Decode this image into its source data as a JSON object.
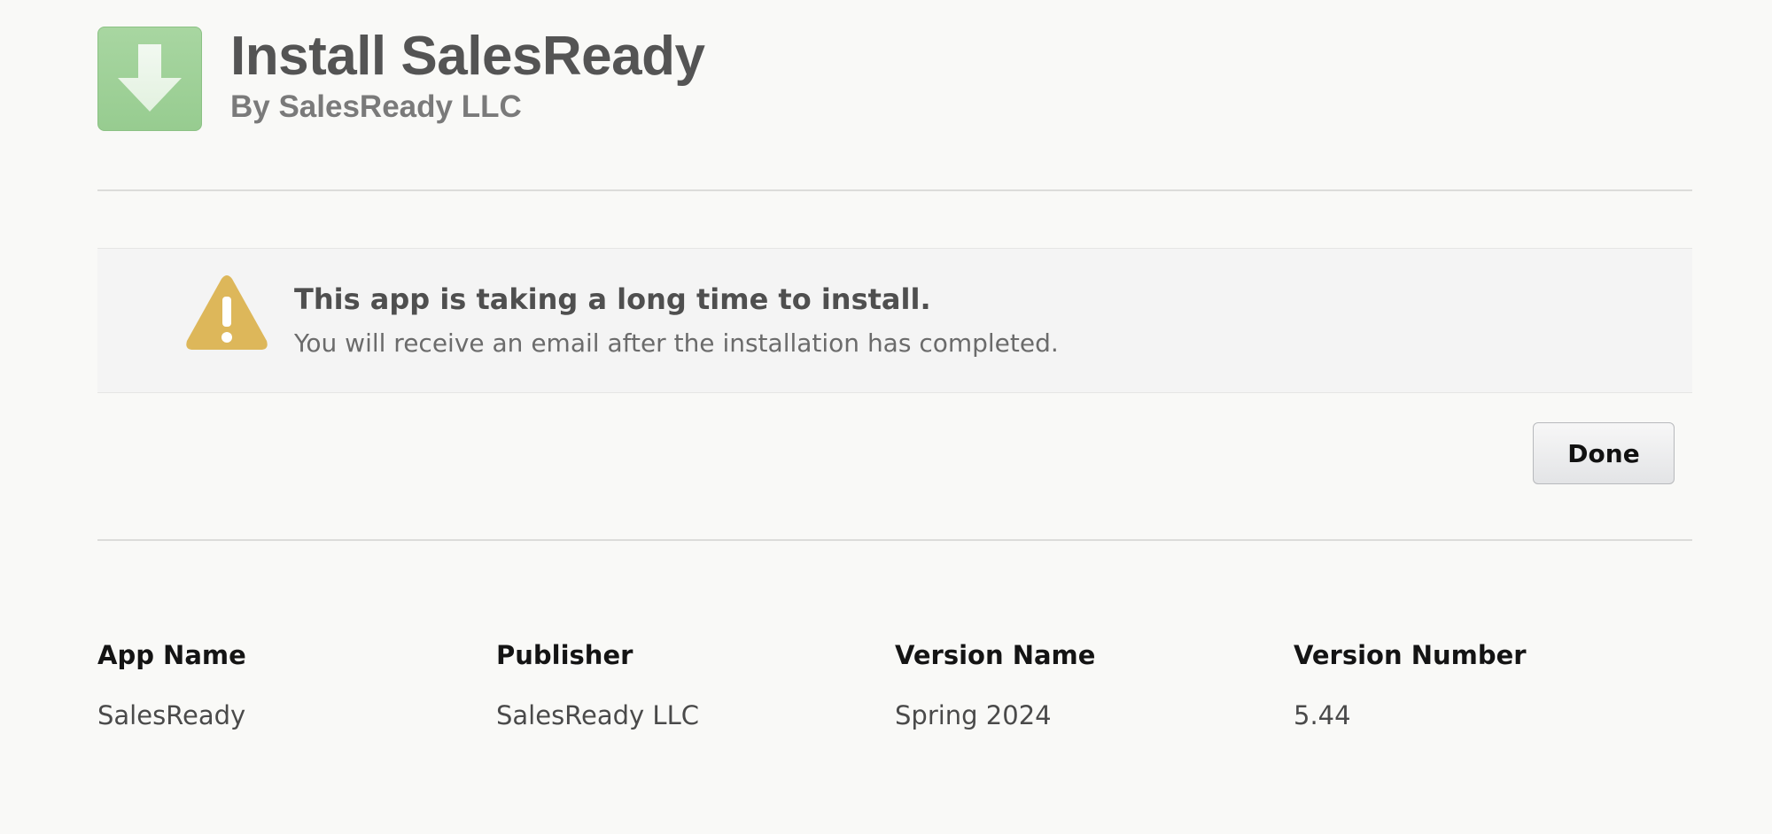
{
  "header": {
    "title": "Install SalesReady",
    "subtitle": "By SalesReady LLC",
    "icon": "download-arrow-icon"
  },
  "notice": {
    "icon": "warning-triangle-icon",
    "title": "This app is taking a long time to install.",
    "message": "You will receive an email after the installation has completed."
  },
  "actions": {
    "done_label": "Done"
  },
  "details": {
    "columns": [
      {
        "label": "App Name",
        "value": "SalesReady"
      },
      {
        "label": "Publisher",
        "value": "SalesReady LLC"
      },
      {
        "label": "Version Name",
        "value": "Spring 2024"
      },
      {
        "label": "Version Number",
        "value": "5.44"
      }
    ]
  },
  "colors": {
    "icon_green": "#9ccf95",
    "warning_yellow": "#ddb75a",
    "background": "#f9f9f7"
  }
}
